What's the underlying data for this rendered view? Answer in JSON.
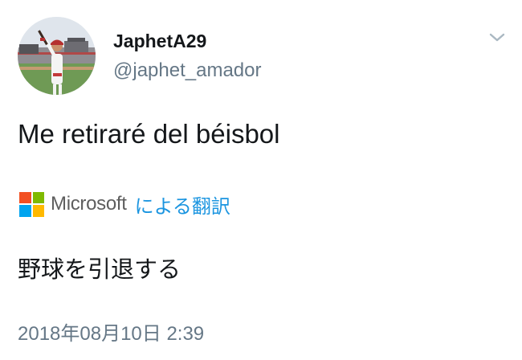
{
  "tweet": {
    "author": {
      "display_name": "JaphetA29",
      "handle": "@japhet_amador",
      "avatar_icon": "baseball-player-avatar"
    },
    "menu_icon": "chevron-down-icon",
    "text": "Me retiraré del béisbol",
    "translation": {
      "provider": "Microsoft",
      "provider_logo_colors": [
        "#f25022",
        "#7fba00",
        "#00a4ef",
        "#ffb900"
      ],
      "label": "による翻訳",
      "text": "野球を引退する"
    },
    "timestamp": "2018年08月10日 2:39"
  },
  "colors": {
    "text_primary": "#14171a",
    "text_secondary": "#657786",
    "link_blue": "#1b95e0",
    "background": "#ffffff"
  }
}
